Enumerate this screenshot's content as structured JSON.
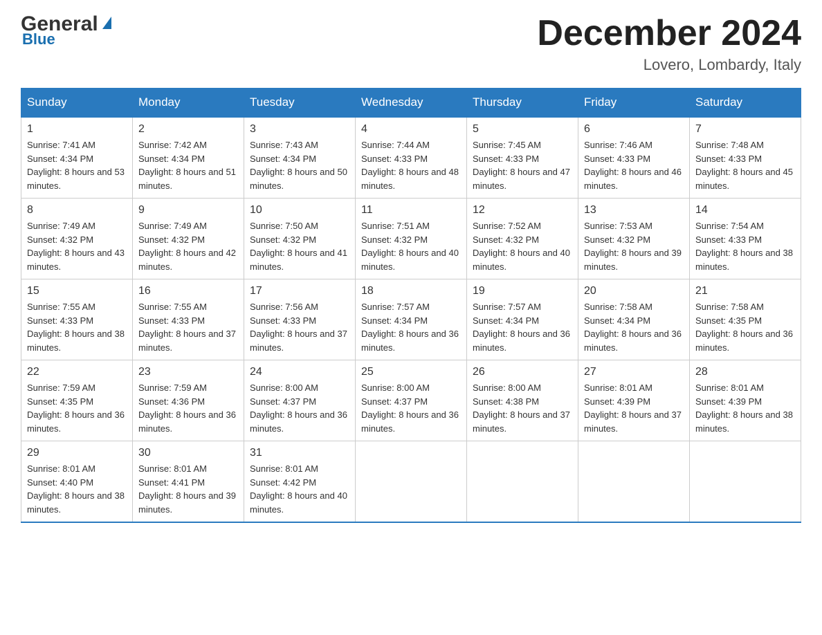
{
  "header": {
    "logo_general": "General",
    "logo_blue": "Blue",
    "month_title": "December 2024",
    "location": "Lovero, Lombardy, Italy"
  },
  "days_of_week": [
    "Sunday",
    "Monday",
    "Tuesday",
    "Wednesday",
    "Thursday",
    "Friday",
    "Saturday"
  ],
  "weeks": [
    [
      {
        "day": "1",
        "sunrise": "7:41 AM",
        "sunset": "4:34 PM",
        "daylight": "8 hours and 53 minutes."
      },
      {
        "day": "2",
        "sunrise": "7:42 AM",
        "sunset": "4:34 PM",
        "daylight": "8 hours and 51 minutes."
      },
      {
        "day": "3",
        "sunrise": "7:43 AM",
        "sunset": "4:34 PM",
        "daylight": "8 hours and 50 minutes."
      },
      {
        "day": "4",
        "sunrise": "7:44 AM",
        "sunset": "4:33 PM",
        "daylight": "8 hours and 48 minutes."
      },
      {
        "day": "5",
        "sunrise": "7:45 AM",
        "sunset": "4:33 PM",
        "daylight": "8 hours and 47 minutes."
      },
      {
        "day": "6",
        "sunrise": "7:46 AM",
        "sunset": "4:33 PM",
        "daylight": "8 hours and 46 minutes."
      },
      {
        "day": "7",
        "sunrise": "7:48 AM",
        "sunset": "4:33 PM",
        "daylight": "8 hours and 45 minutes."
      }
    ],
    [
      {
        "day": "8",
        "sunrise": "7:49 AM",
        "sunset": "4:32 PM",
        "daylight": "8 hours and 43 minutes."
      },
      {
        "day": "9",
        "sunrise": "7:49 AM",
        "sunset": "4:32 PM",
        "daylight": "8 hours and 42 minutes."
      },
      {
        "day": "10",
        "sunrise": "7:50 AM",
        "sunset": "4:32 PM",
        "daylight": "8 hours and 41 minutes."
      },
      {
        "day": "11",
        "sunrise": "7:51 AM",
        "sunset": "4:32 PM",
        "daylight": "8 hours and 40 minutes."
      },
      {
        "day": "12",
        "sunrise": "7:52 AM",
        "sunset": "4:32 PM",
        "daylight": "8 hours and 40 minutes."
      },
      {
        "day": "13",
        "sunrise": "7:53 AM",
        "sunset": "4:32 PM",
        "daylight": "8 hours and 39 minutes."
      },
      {
        "day": "14",
        "sunrise": "7:54 AM",
        "sunset": "4:33 PM",
        "daylight": "8 hours and 38 minutes."
      }
    ],
    [
      {
        "day": "15",
        "sunrise": "7:55 AM",
        "sunset": "4:33 PM",
        "daylight": "8 hours and 38 minutes."
      },
      {
        "day": "16",
        "sunrise": "7:55 AM",
        "sunset": "4:33 PM",
        "daylight": "8 hours and 37 minutes."
      },
      {
        "day": "17",
        "sunrise": "7:56 AM",
        "sunset": "4:33 PM",
        "daylight": "8 hours and 37 minutes."
      },
      {
        "day": "18",
        "sunrise": "7:57 AM",
        "sunset": "4:34 PM",
        "daylight": "8 hours and 36 minutes."
      },
      {
        "day": "19",
        "sunrise": "7:57 AM",
        "sunset": "4:34 PM",
        "daylight": "8 hours and 36 minutes."
      },
      {
        "day": "20",
        "sunrise": "7:58 AM",
        "sunset": "4:34 PM",
        "daylight": "8 hours and 36 minutes."
      },
      {
        "day": "21",
        "sunrise": "7:58 AM",
        "sunset": "4:35 PM",
        "daylight": "8 hours and 36 minutes."
      }
    ],
    [
      {
        "day": "22",
        "sunrise": "7:59 AM",
        "sunset": "4:35 PM",
        "daylight": "8 hours and 36 minutes."
      },
      {
        "day": "23",
        "sunrise": "7:59 AM",
        "sunset": "4:36 PM",
        "daylight": "8 hours and 36 minutes."
      },
      {
        "day": "24",
        "sunrise": "8:00 AM",
        "sunset": "4:37 PM",
        "daylight": "8 hours and 36 minutes."
      },
      {
        "day": "25",
        "sunrise": "8:00 AM",
        "sunset": "4:37 PM",
        "daylight": "8 hours and 36 minutes."
      },
      {
        "day": "26",
        "sunrise": "8:00 AM",
        "sunset": "4:38 PM",
        "daylight": "8 hours and 37 minutes."
      },
      {
        "day": "27",
        "sunrise": "8:01 AM",
        "sunset": "4:39 PM",
        "daylight": "8 hours and 37 minutes."
      },
      {
        "day": "28",
        "sunrise": "8:01 AM",
        "sunset": "4:39 PM",
        "daylight": "8 hours and 38 minutes."
      }
    ],
    [
      {
        "day": "29",
        "sunrise": "8:01 AM",
        "sunset": "4:40 PM",
        "daylight": "8 hours and 38 minutes."
      },
      {
        "day": "30",
        "sunrise": "8:01 AM",
        "sunset": "4:41 PM",
        "daylight": "8 hours and 39 minutes."
      },
      {
        "day": "31",
        "sunrise": "8:01 AM",
        "sunset": "4:42 PM",
        "daylight": "8 hours and 40 minutes."
      },
      {
        "day": "",
        "sunrise": "",
        "sunset": "",
        "daylight": ""
      },
      {
        "day": "",
        "sunrise": "",
        "sunset": "",
        "daylight": ""
      },
      {
        "day": "",
        "sunrise": "",
        "sunset": "",
        "daylight": ""
      },
      {
        "day": "",
        "sunrise": "",
        "sunset": "",
        "daylight": ""
      }
    ]
  ]
}
